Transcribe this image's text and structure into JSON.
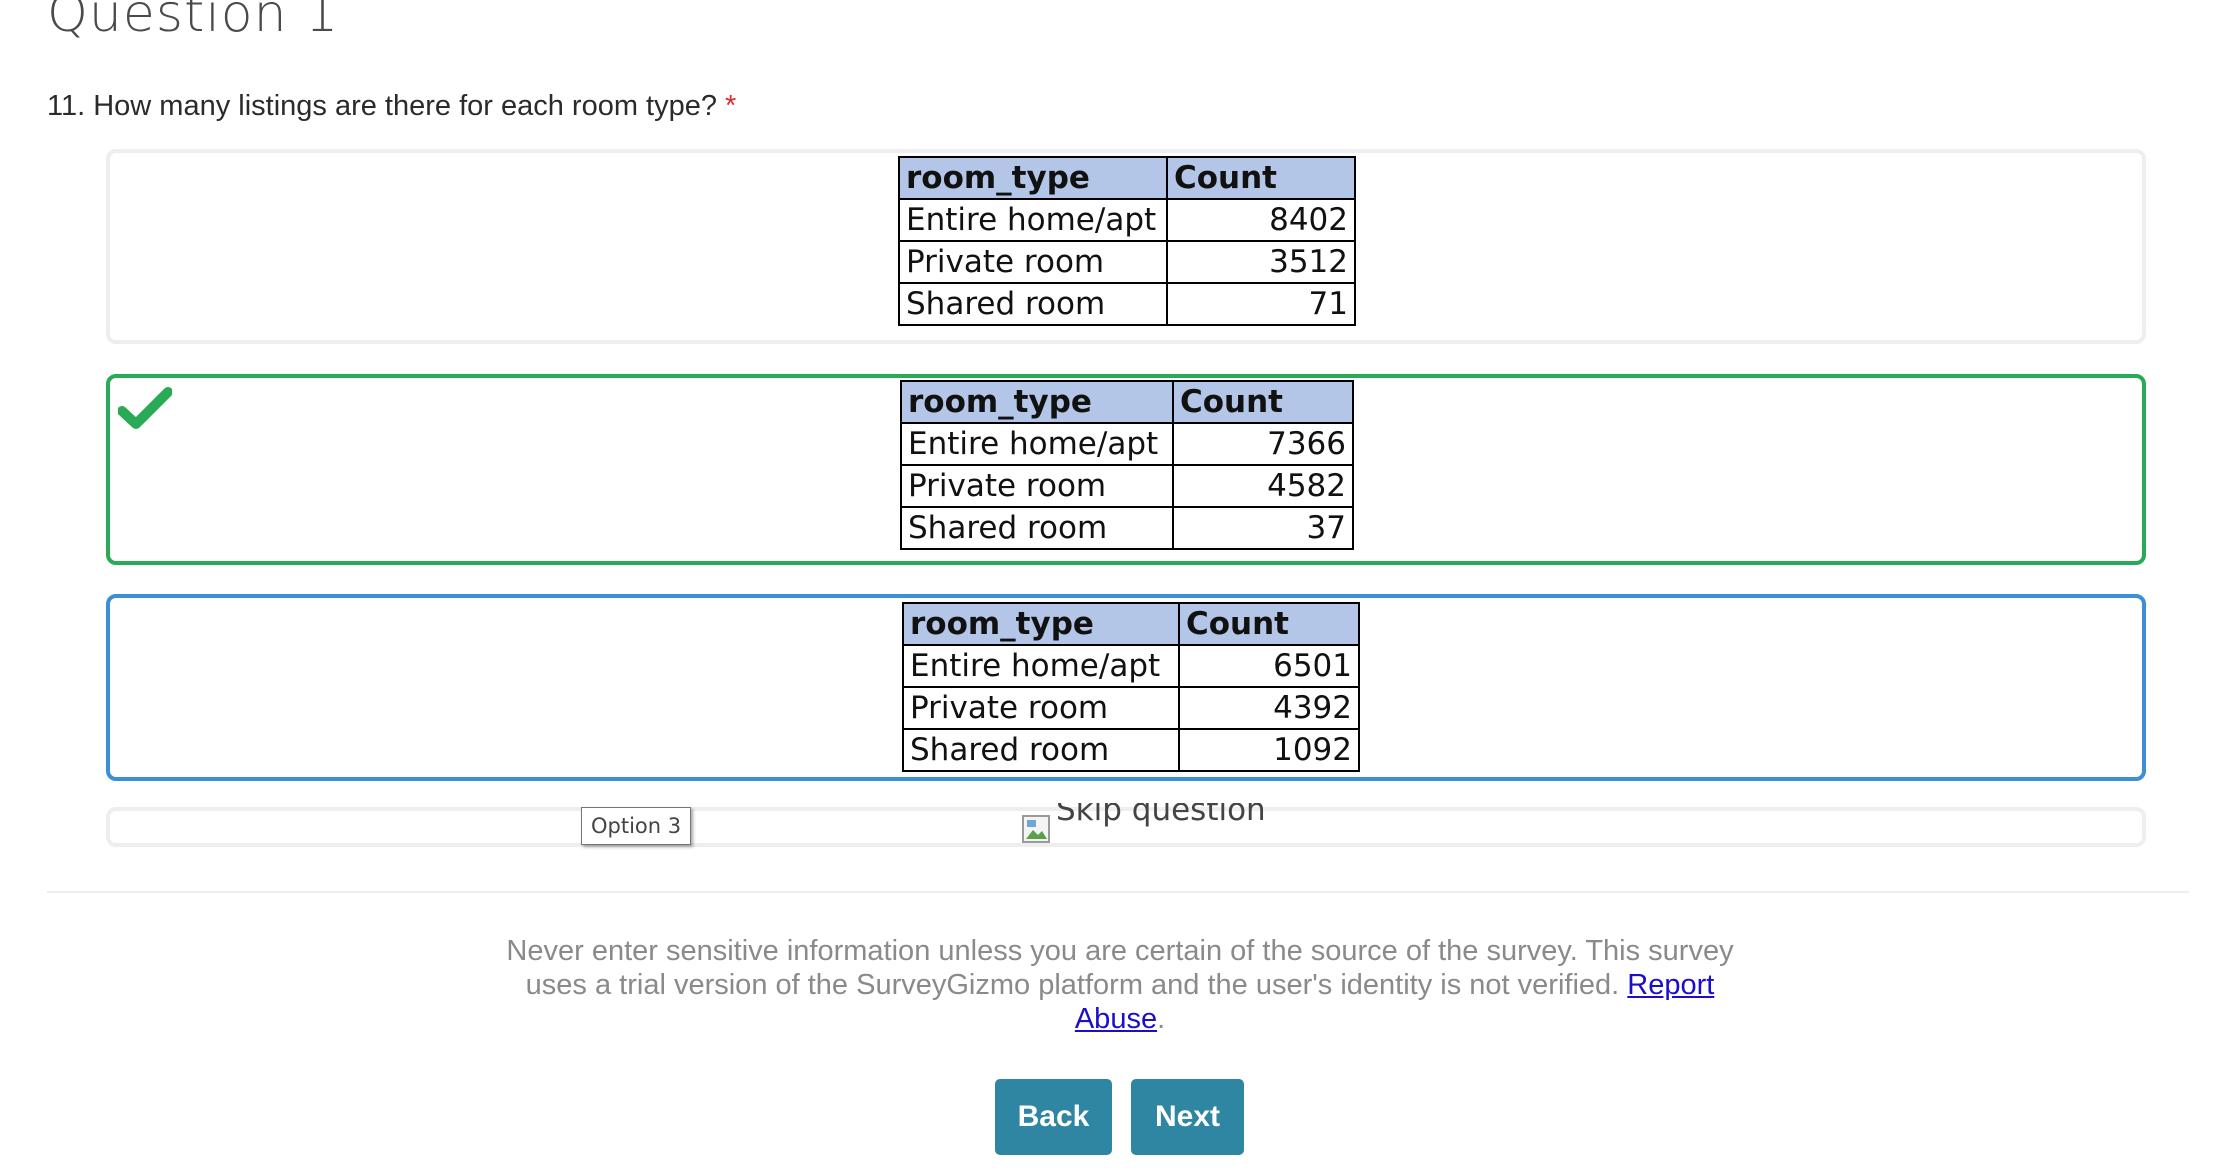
{
  "page": {
    "heading": "Question 1"
  },
  "question": {
    "text": "11. How many listings are there for each room type?",
    "required_marker": "*"
  },
  "options": [
    {
      "columns": [
        "room_type",
        "Count"
      ],
      "rows": [
        {
          "room_type": "Entire home/apt",
          "count": "8402"
        },
        {
          "room_type": "Private room",
          "count": "3512"
        },
        {
          "room_type": "Shared room",
          "count": "71"
        }
      ],
      "state": "unselected"
    },
    {
      "columns": [
        "room_type",
        "Count"
      ],
      "rows": [
        {
          "room_type": "Entire home/apt",
          "count": "7366"
        },
        {
          "room_type": "Private room",
          "count": "4582"
        },
        {
          "room_type": "Shared room",
          "count": "37"
        }
      ],
      "state": "selected",
      "marker_icon": "checkmark-icon"
    },
    {
      "columns": [
        "room_type",
        "Count"
      ],
      "rows": [
        {
          "room_type": "Entire home/apt",
          "count": "6501"
        },
        {
          "room_type": "Private room",
          "count": "4392"
        },
        {
          "room_type": "Shared room",
          "count": "1092"
        }
      ],
      "state": "hovered"
    }
  ],
  "skip": {
    "alt_text": "Skip question",
    "icon": "broken-image-icon"
  },
  "tooltip": {
    "text": "Option 3"
  },
  "footer": {
    "disclaimer": "Never enter sensitive information unless you are certain of the source of the survey. This survey uses a trial version of the SurveyGizmo platform and the user's identity is not verified.",
    "report_link": "Report Abuse",
    "trailing": "."
  },
  "nav": {
    "back_label": "Back",
    "next_label": "Next"
  },
  "colors": {
    "selected_border": "#29aa57",
    "hover_border": "#3a8fd6",
    "table_header_bg": "#b4c6e7",
    "button_bg": "#2e86a3",
    "required_star": "#e0262a",
    "link": "#1a0dcc"
  }
}
